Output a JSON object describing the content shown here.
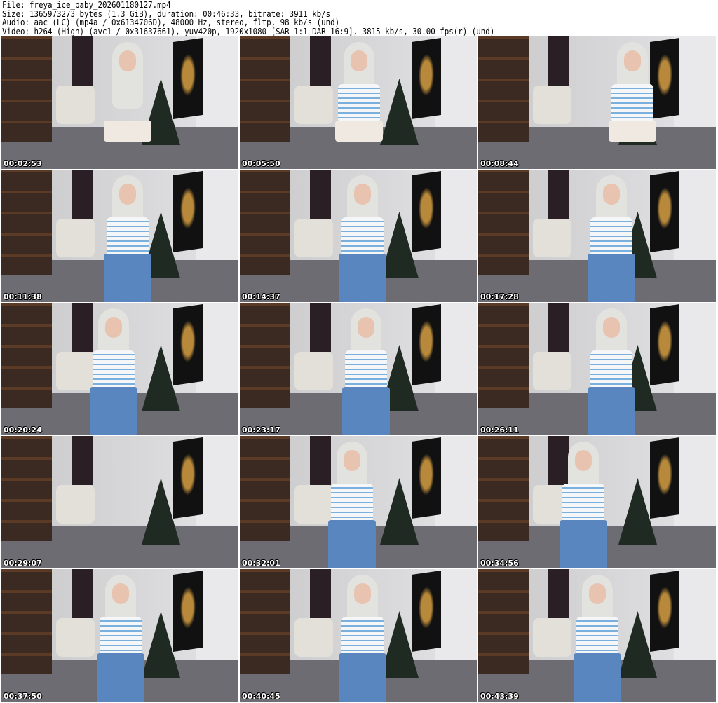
{
  "header": {
    "file": "File: freya_ice_baby_202601180127.mp4",
    "size": "Size: 1365973273 bytes (1.3 GiB), duration: 00:46:33, bitrate: 3911 kb/s",
    "audio": "Audio: aac (LC) (mp4a / 0x6134706D), 48000 Hz, stereo, fltp, 98 kb/s (und)",
    "video": "Video: h264 (High) (avc1 / 0x31637661), yuv420p, 1920x1080 [SAR 1:1 DAR 16:9], 3815 kb/s, 30.00 fps(r) (und)"
  },
  "thumbnails": [
    {
      "timestamp": "00:02:53"
    },
    {
      "timestamp": "00:05:50"
    },
    {
      "timestamp": "00:08:44"
    },
    {
      "timestamp": "00:11:38"
    },
    {
      "timestamp": "00:14:37"
    },
    {
      "timestamp": "00:17:28"
    },
    {
      "timestamp": "00:20:24"
    },
    {
      "timestamp": "00:23:17"
    },
    {
      "timestamp": "00:26:11"
    },
    {
      "timestamp": "00:29:07"
    },
    {
      "timestamp": "00:32:01"
    },
    {
      "timestamp": "00:34:56"
    },
    {
      "timestamp": "00:37:50"
    },
    {
      "timestamp": "00:40:45"
    },
    {
      "timestamp": "00:43:39"
    }
  ]
}
